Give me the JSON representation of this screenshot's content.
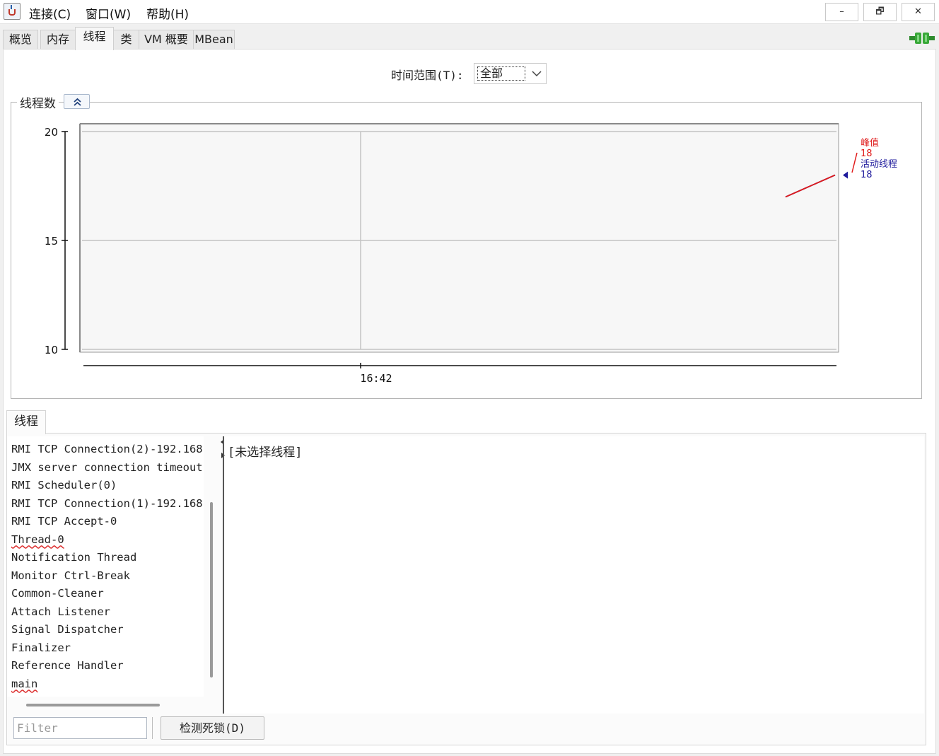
{
  "menu": {
    "connect": "连接(C)",
    "window": "窗口(W)",
    "help": "帮助(H)"
  },
  "window_buttons": {
    "minimize": "–",
    "restore": "🗗",
    "close": "✕"
  },
  "tabs": [
    {
      "label": "概览",
      "active": false
    },
    {
      "label": "内存",
      "active": false
    },
    {
      "label": "线程",
      "active": true
    },
    {
      "label": "类",
      "active": false
    },
    {
      "label": "VM 概要",
      "active": false
    },
    {
      "label": "MBean",
      "active": false
    }
  ],
  "time_range": {
    "label": "时间范围(T):",
    "value": "全部"
  },
  "chart_panel": {
    "title": "线程数"
  },
  "chart_data": {
    "type": "line",
    "title": "线程数",
    "xlabel": "",
    "ylabel": "",
    "x_ticks": [
      "16:42"
    ],
    "y_ticks": [
      10,
      15,
      20
    ],
    "ylim": [
      10,
      20
    ],
    "grid": true,
    "series": [
      {
        "name": "峰值",
        "value_label": "18",
        "color": "#e01a1a",
        "values": [
          17,
          18
        ]
      },
      {
        "name": "活动线程",
        "value_label": "18",
        "color": "#1e1a9c",
        "values": [
          17,
          18
        ]
      }
    ],
    "legend": "right"
  },
  "threads": {
    "tab_label": "线程",
    "items": [
      "RMI TCP Connection(2)-192.168.",
      "JMX server connection timeout",
      "RMI Scheduler(0)",
      "RMI TCP Connection(1)-192.168.",
      "RMI TCP Accept-0",
      "Thread-0",
      "Notification Thread",
      "Monitor Ctrl-Break",
      "Common-Cleaner",
      "Attach Listener",
      "Signal Dispatcher",
      "Finalizer",
      "Reference Handler",
      "main"
    ],
    "detail_text": "[未选择线程]",
    "filter_placeholder": "Filter",
    "deadlock_button": "检测死锁(D)"
  },
  "colors": {
    "peak": "#e01a1a",
    "live": "#1e1a9c"
  }
}
